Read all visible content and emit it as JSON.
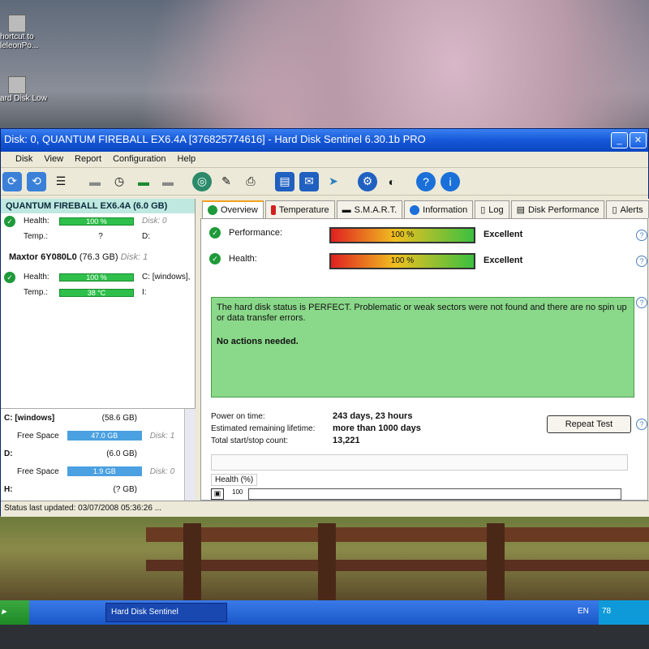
{
  "desktop": {
    "icons": [
      {
        "label": "hortcut to\nleleonPo..."
      },
      {
        "label": "ard Disk Low"
      }
    ]
  },
  "window": {
    "title": "Disk: 0, QUANTUM FIREBALL EX6.4A [376825774616]  -  Hard Disk Sentinel 6.30.1b PRO",
    "controls": {
      "minimize": "_",
      "close": "✕"
    }
  },
  "menu": [
    "Disk",
    "View",
    "Report",
    "Configuration",
    "Help"
  ],
  "left_panel": {
    "disk1": {
      "name": "QUANTUM FIREBALL EX6.4A",
      "size": "(6.0 GB)",
      "health_label": "Health:",
      "health_value": "100 %",
      "disk_ref": "Disk: 0",
      "temp_label": "Temp.:",
      "temp_value": "?",
      "drive": "D:"
    },
    "disk2": {
      "name": "Maxtor 6Y080L0",
      "size": "(76.3 GB)",
      "disk_ref": "Disk: 1",
      "health_label": "Health:",
      "health_value": "100 %",
      "drive": "C: [windows],",
      "temp_label": "Temp.:",
      "temp_value": "38 °C",
      "drive2": "I:"
    },
    "volumes": [
      {
        "name": "C: [windows]",
        "size": "(58.6 GB)",
        "free_label": "Free Space",
        "free_value": "47.0 GB",
        "disk_ref": "Disk: 1"
      },
      {
        "name": "D:",
        "size": "(6.0 GB)",
        "free_label": "Free Space",
        "free_value": "1.9 GB",
        "disk_ref": "Disk: 0"
      },
      {
        "name": "H:",
        "size": "(? GB)"
      }
    ]
  },
  "tabs": [
    "Overview",
    "Temperature",
    "S.M.A.R.T.",
    "Information",
    "Log",
    "Disk Performance",
    "Alerts"
  ],
  "overview": {
    "performance_label": "Performance:",
    "performance_value": "100 %",
    "performance_verdict": "Excellent",
    "health_label": "Health:",
    "health_value": "100 %",
    "health_verdict": "Excellent",
    "status_text": "The hard disk status is PERFECT. Problematic or weak sectors were not found and there are no spin up or data transfer errors.",
    "action_text": "No actions needed.",
    "stats": [
      {
        "label": "Power on time:",
        "value": "243 days, 23 hours"
      },
      {
        "label": "Estimated remaining lifetime:",
        "value": "more than 1000 days"
      },
      {
        "label": "Total start/stop count:",
        "value": "13,221"
      }
    ],
    "repeat_button": "Repeat Test",
    "health_group_label": "Health (%)",
    "health_axis": "100"
  },
  "statusbar": {
    "text": "Status last updated: 03/07/2008 05:36:26 ..."
  },
  "taskbar": {
    "task": "Hard Disk Sentinel",
    "lang": "EN",
    "tray": "78"
  }
}
